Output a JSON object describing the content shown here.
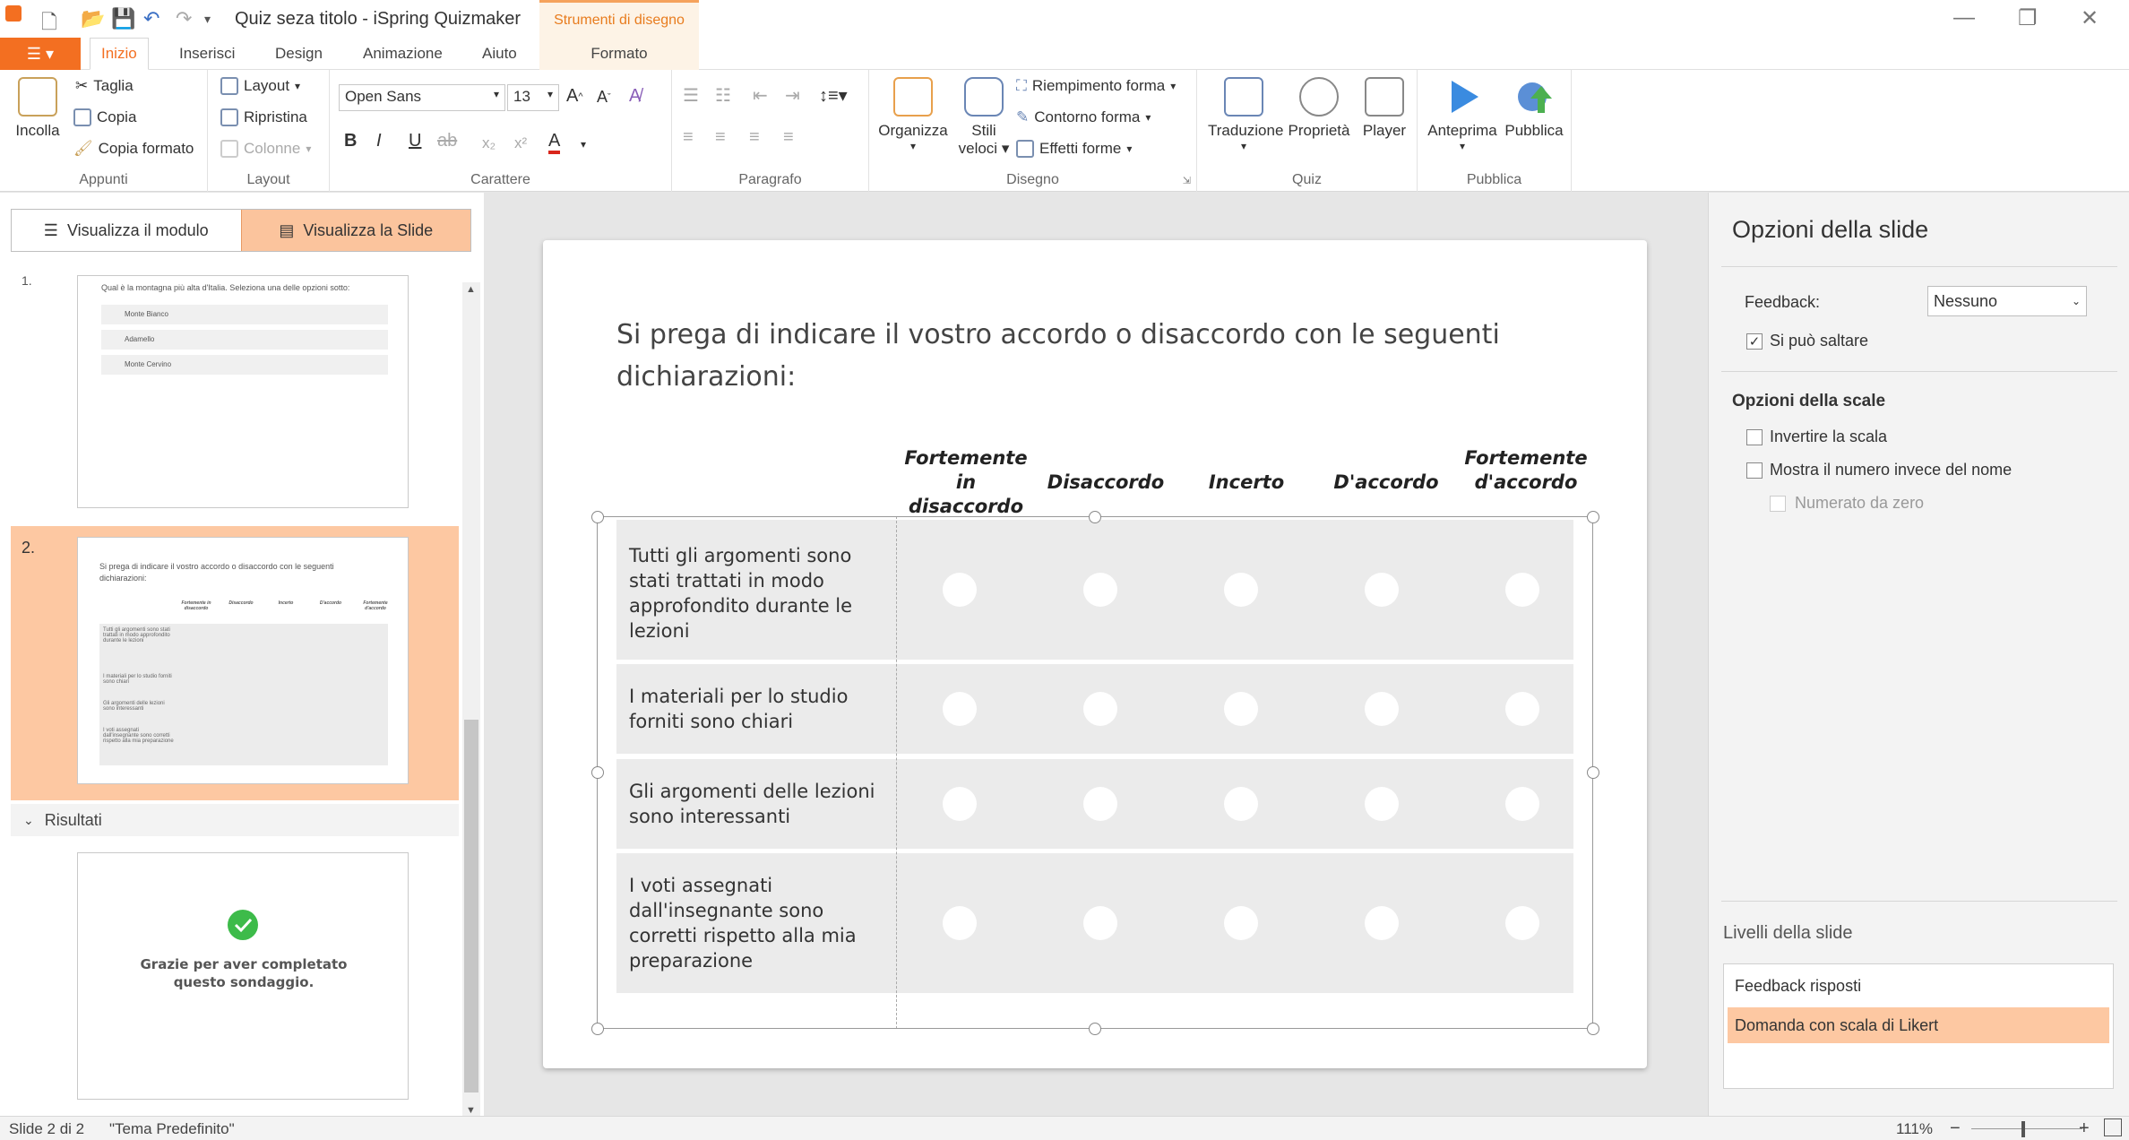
{
  "titlebar": {
    "title": "Quiz seza titolo - iSpring Quizmaker",
    "contextual_tab": "Strumenti di disegno",
    "minimize": "—",
    "restore": "❐",
    "close": "✕"
  },
  "tabs": {
    "file": "☰ ▾",
    "items": [
      "Inizio",
      "Inserisci",
      "Design",
      "Animazione",
      "Aiuto",
      "Formato"
    ],
    "active": "Inizio"
  },
  "ribbon": {
    "appunti": {
      "label": "Appunti",
      "incolla": "Incolla",
      "taglia": "Taglia",
      "copia": "Copia",
      "copia_formato": "Copia formato"
    },
    "layout": {
      "label": "Layout",
      "layout": "Layout",
      "ripristina": "Ripristina",
      "colonne": "Colonne"
    },
    "carattere": {
      "label": "Carattere",
      "font": "Open Sans",
      "size": "13",
      "bold": "B",
      "italic": "I",
      "underline": "U",
      "strike": "ab",
      "sub": "x₂",
      "sup": "x²",
      "color": "A"
    },
    "paragrafo": {
      "label": "Paragrafo"
    },
    "disegno": {
      "label": "Disegno",
      "organizza": "Organizza",
      "stili": "Stili",
      "veloci": "veloci",
      "riempimento": "Riempimento forma",
      "contorno": "Contorno forma",
      "effetti": "Effetti forme"
    },
    "quiz": {
      "label": "Quiz",
      "traduzione": "Traduzione",
      "proprieta": "Proprietà",
      "player": "Player"
    },
    "pubblica": {
      "label": "Pubblica",
      "anteprima": "Anteprima",
      "pubblica": "Pubblica"
    }
  },
  "left_panel": {
    "view_module": "Visualizza il modulo",
    "view_slide": "Visualizza la Slide",
    "slide1": {
      "number": "1.",
      "question": "Qual è la montagna più alta d'Italia. Seleziona una delle opzioni sotto:",
      "options": [
        "Monte Bianco",
        "Adamello",
        "Monte Cervino"
      ]
    },
    "slide2": {
      "number": "2.",
      "question": "Si prega di indicare il vostro accordo o disaccordo con le seguenti dichiarazioni:",
      "scale": [
        "Fortemente in disaccordo",
        "Disaccordo",
        "Incerto",
        "D'accordo",
        "Fortemente d'accordo"
      ],
      "rows": [
        "Tutti gli argomenti sono stati trattati in modo approfondito durante le lezioni",
        "I materiali per lo studio forniti sono chiari",
        "Gli argomenti delle lezioni sono interessanti",
        "I voti assegnati dall'insegnante sono corretti rispetto alla mia preparazione"
      ]
    },
    "results_header": "Risultati",
    "results_text": "Grazie per aver completato questo sondaggio."
  },
  "slide": {
    "question": "Si prega di indicare il vostro accordo o disaccordo con le seguenti dichiarazioni:",
    "scale": [
      {
        "l1": "Fortemente",
        "l2": "in disaccordo"
      },
      {
        "l1": "",
        "l2": "Disaccordo"
      },
      {
        "l1": "",
        "l2": "Incerto"
      },
      {
        "l1": "",
        "l2": "D'accordo"
      },
      {
        "l1": "Fortemente",
        "l2": "d'accordo"
      }
    ],
    "statements": [
      "Tutti gli argomenti sono stati trattati in modo approfondito durante le lezioni",
      "I materiali per lo studio forniti sono chiari",
      "Gli argomenti delle lezioni sono interessanti",
      "I voti assegnati dall'insegnante sono corretti rispetto alla mia preparazione"
    ]
  },
  "right_panel": {
    "title": "Opzioni della slide",
    "feedback_label": "Feedback:",
    "feedback_value": "Nessuno",
    "skip_label": "Si può saltare",
    "skip_checked": true,
    "scale_options_title": "Opzioni della scale",
    "invert_label": "Invertire la scala",
    "show_number_label": "Mostra il numero invece del nome",
    "zero_label": "Numerato da zero",
    "layers_title": "Livelli della slide",
    "layers": [
      "Feedback risposti",
      "Domanda con scala di Likert"
    ],
    "selected_layer": "Domanda con scala di Likert"
  },
  "statusbar": {
    "slide_info": "Slide 2 di 2",
    "theme": "\"Tema Predefinito\"",
    "zoom": "111%",
    "zoom_out": "−",
    "zoom_in": "+"
  },
  "colors": {
    "accent": "#f36f21",
    "selected": "#fdc8a2",
    "row_bg": "#ebebeb",
    "check": "#3dbb4a"
  }
}
